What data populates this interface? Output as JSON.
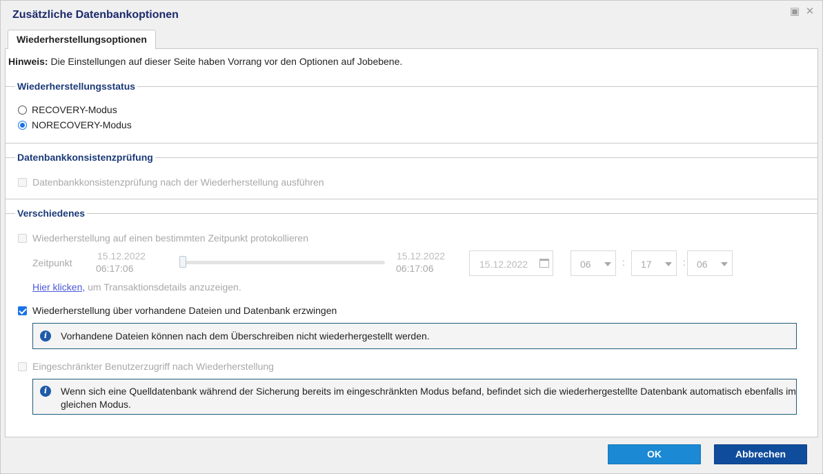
{
  "dialog": {
    "title": "Zusätzliche Datenbankoptionen",
    "tab": "Wiederherstellungsoptionen",
    "hint_label": "Hinweis:",
    "hint_text": " Die Einstellungen auf dieser Seite haben Vorrang vor den Optionen auf Jobebene."
  },
  "recovery_status": {
    "legend": "Wiederherstellungsstatus",
    "options": [
      {
        "label": "RECOVERY-Modus",
        "checked": false
      },
      {
        "label": "NORECOVERY-Modus",
        "checked": true
      }
    ]
  },
  "consistency": {
    "legend": "Datenbankkonsistenzprüfung",
    "checkbox_label": "Datenbankkonsistenzprüfung nach der Wiederherstellung ausführen"
  },
  "misc": {
    "legend": "Verschiedenes",
    "pit_label": "Wiederherstellung auf einen bestimmten Zeitpunkt protokollieren",
    "zeitpunkt_label": "Zeitpunkt",
    "start_date": "15.12.2022",
    "start_time": "06:17:06",
    "end_date": "15.12.2022",
    "end_time": "06:17:06",
    "date_value": "15.12.2022",
    "hour": "06",
    "minute": "17",
    "second": "06",
    "link_text": "Hier klicken,",
    "link_suffix": " um Transaktionsdetails anzuzeigen.",
    "force_label": "Wiederherstellung über vorhandene Dateien und Datenbank erzwingen",
    "force_info": "Vorhandene Dateien können nach dem Überschreiben nicht wiederhergestellt werden.",
    "restricted_label": "Eingeschränkter Benutzerzugriff nach Wiederherstellung",
    "restricted_info": "Wenn sich eine Quelldatenbank während der Sicherung bereits im eingeschränkten Modus befand, befindet sich die wiederhergestellte Datenbank automatisch ebenfalls im gleichen Modus."
  },
  "buttons": {
    "ok": "OK",
    "cancel": "Abbrechen"
  },
  "colors": {
    "accent": "#1a73e8",
    "ok_button": "#1b89d3",
    "cancel_button": "#0f4c9c",
    "legend": "#1b3a78"
  },
  "icons": [
    "restore-icon",
    "close-icon",
    "calendar-icon",
    "info-icon"
  ]
}
